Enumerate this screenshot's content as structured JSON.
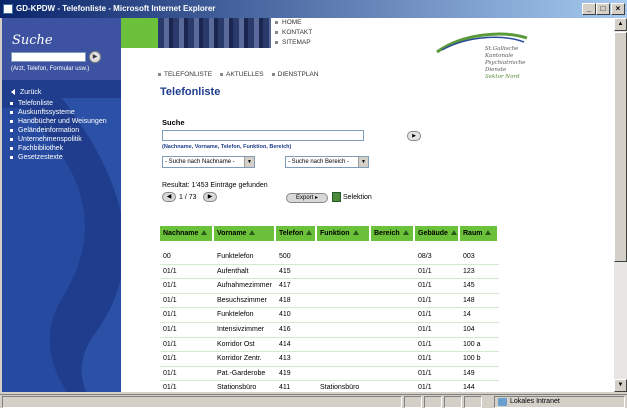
{
  "window": {
    "title": "GD-KPDW - Telefonliste - Microsoft Internet Explorer"
  },
  "sidebar": {
    "search_title": "Suche",
    "search_hint": "(Arzt, Telefon, Formular usw.)",
    "back_label": "Zurück",
    "items": [
      {
        "label": "Telefonliste"
      },
      {
        "label": "Auskunftssysteme"
      },
      {
        "label": "Handbücher und Weisungen"
      },
      {
        "label": "Geländeinformation"
      },
      {
        "label": "Unternehmenspolitik"
      },
      {
        "label": "Fachbibliothek"
      },
      {
        "label": "Gesetzestexte"
      }
    ]
  },
  "header": {
    "top_menu": [
      {
        "label": "HOME"
      },
      {
        "label": "KONTAKT"
      },
      {
        "label": "SITEMAP"
      }
    ],
    "logo_lines": [
      "St.Gallische",
      "Kantonale",
      "Psychiatrische",
      "Dienste"
    ],
    "logo_sektor": "Sektor Nord",
    "nav": [
      {
        "label": "TELEFONLISTE"
      },
      {
        "label": "AKTUELLES"
      },
      {
        "label": "DIENSTPLAN"
      }
    ]
  },
  "content": {
    "page_title": "Telefonliste",
    "search_label": "Suche",
    "search_hint": "(Nachname, Vorname, Telefon, Funktion, Bereich)",
    "select_name": "- Suche nach Nachname -",
    "select_area": "- Suche nach Bereich -",
    "result_text": "Resultat: 1'453 Einträge gefunden",
    "pager_text": "1 / 73",
    "export_label": "Export",
    "selection_label": "Selektion"
  },
  "table": {
    "headers": [
      "Nachname",
      "Vorname",
      "Telefon",
      "Funktion",
      "Bereich",
      "Gebäude",
      "Raum"
    ],
    "rows": [
      [
        "00",
        "Funktelefon",
        "500",
        "",
        "",
        "08/3",
        "003"
      ],
      [
        "01/1",
        "Aufenthalt",
        "415",
        "",
        "",
        "01/1",
        "123"
      ],
      [
        "01/1",
        "Aufnahmezimmer",
        "417",
        "",
        "",
        "01/1",
        "145"
      ],
      [
        "01/1",
        "Besuchszimmer",
        "418",
        "",
        "",
        "01/1",
        "148"
      ],
      [
        "01/1",
        "Funktelefon",
        "410",
        "",
        "",
        "01/1",
        "14"
      ],
      [
        "01/1",
        "Intensivzimmer",
        "416",
        "",
        "",
        "01/1",
        "104"
      ],
      [
        "01/1",
        "Korridor Ost",
        "414",
        "",
        "",
        "01/1",
        "100 a"
      ],
      [
        "01/1",
        "Korridor Zentr.",
        "413",
        "",
        "",
        "01/1",
        "100 b"
      ],
      [
        "01/1",
        "Pat.-Garderobe",
        "419",
        "",
        "",
        "01/1",
        "149"
      ],
      [
        "01/1",
        "Stationsbüro",
        "411",
        "Stationsbüro",
        "",
        "01/1",
        "144"
      ]
    ]
  },
  "statusbar": {
    "zone": "Lokales Intranet"
  },
  "colors": {
    "titlebar": "#0a246a",
    "sidebar": "#1f3d8c",
    "accent_green": "#6bc23a"
  }
}
